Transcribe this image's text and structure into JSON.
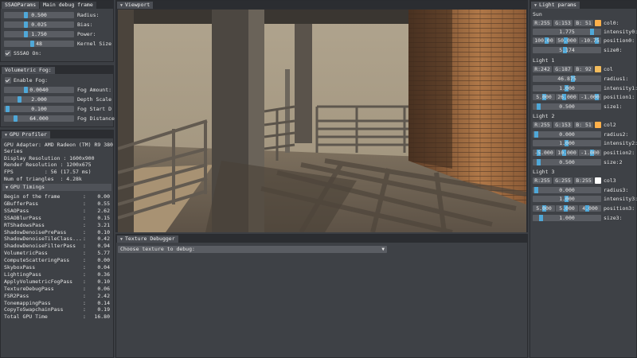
{
  "ssao": {
    "tabs": [
      "SSAOParams",
      "Main debug frame"
    ],
    "rows": [
      {
        "value": "0.500",
        "label": "Radius:",
        "fill": 0.3
      },
      {
        "value": "0.025",
        "label": "Bias:",
        "fill": 0.3
      },
      {
        "value": "1.750",
        "label": "Power:",
        "fill": 0.3
      },
      {
        "value": "48",
        "label": "Kernel Size",
        "fill": 0.4
      }
    ],
    "checkbox_label": "SSSAO On:"
  },
  "fog": {
    "tab": "Volumetric Fog:",
    "checkbox_label": "Enable Fog:",
    "rows": [
      {
        "value": "0.0040",
        "label": "Fog Amount:",
        "fill": 0.3
      },
      {
        "value": "2.000",
        "label": "Depth Scale",
        "fill": 0.2
      },
      {
        "value": "0.100",
        "label": "Fog Start D",
        "fill": 0.02
      },
      {
        "value": "64.000",
        "label": "Fog Distance",
        "fill": 0.15
      }
    ]
  },
  "profiler": {
    "tab": "GPU Profiler",
    "adapter": "GPU Adapter: AMD Radeon (TM) R9 380\nSeries",
    "display_res": "Display Resolution : 1600x900",
    "render_res": "Render Resolution : 1200x675",
    "fps": "FPS          : 56 (17.57 ms)",
    "triangles": "Num of triangles  : 4.28k",
    "timings_header": "GPU Timings",
    "timings": [
      {
        "name": "Begin of the frame",
        "value": "0.00"
      },
      {
        "name": "GBufferPass",
        "value": "0.55"
      },
      {
        "name": "SSAOPass",
        "value": "2.62"
      },
      {
        "name": "SSAOBlurPass",
        "value": "0.15"
      },
      {
        "name": "RTShadowsPass",
        "value": "3.21"
      },
      {
        "name": "ShadowDenoisePrePass",
        "value": "0.10"
      },
      {
        "name": "ShadowDenoiseTileClass...",
        "value": "0.42"
      },
      {
        "name": "ShadowDenoiseFilterPass",
        "value": "0.94"
      },
      {
        "name": "VolumetricPass",
        "value": "5.77"
      },
      {
        "name": "ComputeScatteringPass",
        "value": "0.00"
      },
      {
        "name": "SkyboxPass",
        "value": "0.04"
      },
      {
        "name": "LightingPass",
        "value": "0.36"
      },
      {
        "name": "ApplyVolumetricFogPass",
        "value": "0.10"
      },
      {
        "name": "TextureDebugPass",
        "value": "0.06"
      },
      {
        "name": "FSR2Pass",
        "value": "2.42"
      },
      {
        "name": "TonemappingPass",
        "value": "0.14"
      },
      {
        "name": "CopyToSwapchainPass",
        "value": "0.19"
      },
      {
        "name": "Total GPU Time",
        "value": "16.80"
      }
    ]
  },
  "viewport": {
    "tab": "Viewport"
  },
  "texture_debugger": {
    "tab": "Texture Debugger",
    "select_value": "Choose texture to debug:"
  },
  "lights": {
    "tab": "Light params",
    "sun": {
      "title": "Sun",
      "col_r": "R:255",
      "col_g": "G:153",
      "col_b": "B: 51",
      "col_label": "col0:",
      "col_color": "#ffb04a",
      "intensity": "1.775",
      "intensity_label": "intensity0:",
      "pos": [
        "100.00",
        "50.000",
        "-10.75"
      ],
      "pos_label": "position0:",
      "size": "5.174",
      "size_label": "size0:"
    },
    "light1": {
      "title": "Light 1",
      "col_r": "R:242",
      "col_g": "G:187",
      "col_b": "B: 92",
      "col_label": "col",
      "col_color": "#f2bb5c",
      "radius": "46.875",
      "radius_label": "radius1:",
      "intensity": "1.000",
      "intensity_label": "intensity1:",
      "pos": [
        "5.000",
        "26.000",
        "-1.000"
      ],
      "pos_label": "position1:",
      "size": "0.500",
      "size_label": "size1:"
    },
    "light2": {
      "title": "Light 2",
      "col_r": "R:255",
      "col_g": "G:153",
      "col_b": "B: 51",
      "col_label": "col2",
      "col_color": "#ffb04a",
      "radius": "0.000",
      "radius_label": "radius2:",
      "intensity": "1.000",
      "intensity_label": "intensity2:",
      "pos": [
        "-5.000",
        "10.000",
        "-1.000"
      ],
      "pos_label": "position2:",
      "size": "0.500",
      "size_label": "size:2"
    },
    "light3": {
      "title": "Light 3",
      "col_r": "R:255",
      "col_g": "G:255",
      "col_b": "B:255",
      "col_label": "col3",
      "col_color": "#ffffff",
      "radius": "0.000",
      "radius_label": "radius3:",
      "intensity": "1.000",
      "intensity_label": "intensity3:",
      "pos": [
        "5.000",
        "5.000",
        "4.000"
      ],
      "pos_label": "position3:",
      "size": "1.000",
      "size_label": "size3:"
    }
  }
}
